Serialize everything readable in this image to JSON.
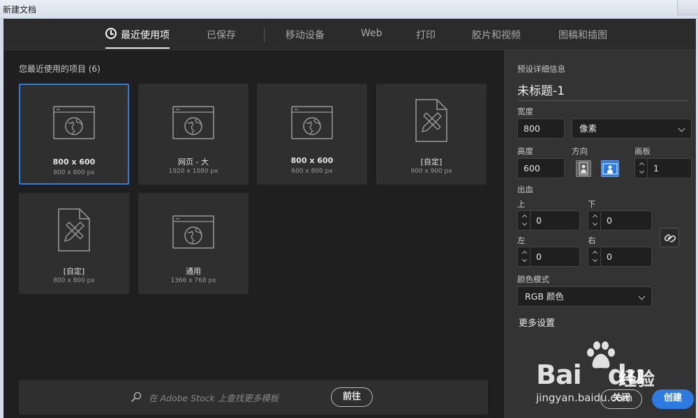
{
  "window": {
    "title": "新建文档"
  },
  "tabs": [
    {
      "label": "最近使用项",
      "active": true
    },
    {
      "label": "已保存"
    },
    {
      "label": "移动设备"
    },
    {
      "label": "Web"
    },
    {
      "label": "打印"
    },
    {
      "label": "胶片和视频"
    },
    {
      "label": "图稿和插图"
    }
  ],
  "recent": {
    "title": "您最近使用的项目",
    "count": "(6)",
    "items": [
      {
        "name": "800 x 600",
        "size": "800 x 600 px",
        "icon": "web-globe-icon",
        "selected": true
      },
      {
        "name": "网页 - 大",
        "size": "1920 x 1080 px",
        "icon": "web-globe-icon"
      },
      {
        "name": "800 x 600",
        "size": "600 x 800 px",
        "icon": "web-globe-icon"
      },
      {
        "name": "[自定]",
        "size": "900 x 900 px",
        "icon": "document-pencil-icon"
      },
      {
        "name": "[自定]",
        "size": "800 x 800 px",
        "icon": "document-pencil-icon"
      },
      {
        "name": "通用",
        "size": "1366 x 768 px",
        "icon": "web-globe-icon"
      }
    ]
  },
  "stock": {
    "placeholder": "在 Adobe Stock 上查找更多模板",
    "go_label": "前往"
  },
  "preset": {
    "section_title": "预设详细信息",
    "doc_name": "未标题-1",
    "width_label": "宽度",
    "width_value": "800",
    "unit": "像素",
    "height_label": "高度",
    "height_value": "600",
    "orientation_label": "方向",
    "artboard_label": "画板",
    "artboard_value": "1",
    "bleed_label": "出血",
    "bleed_top_label": "上",
    "bleed_top": "0",
    "bleed_bottom_label": "下",
    "bleed_bottom": "0",
    "bleed_left_label": "左",
    "bleed_left": "0",
    "bleed_right_label": "右",
    "bleed_right": "0",
    "color_mode_label": "颜色模式",
    "color_mode": "RGB 颜色",
    "more_settings": "更多设置"
  },
  "buttons": {
    "close": "关闭",
    "create": "创建"
  },
  "watermark": {
    "brand": "Bai",
    "brand2": "du",
    "jingyan": "经验",
    "url": "jingyan.baidu.com"
  }
}
